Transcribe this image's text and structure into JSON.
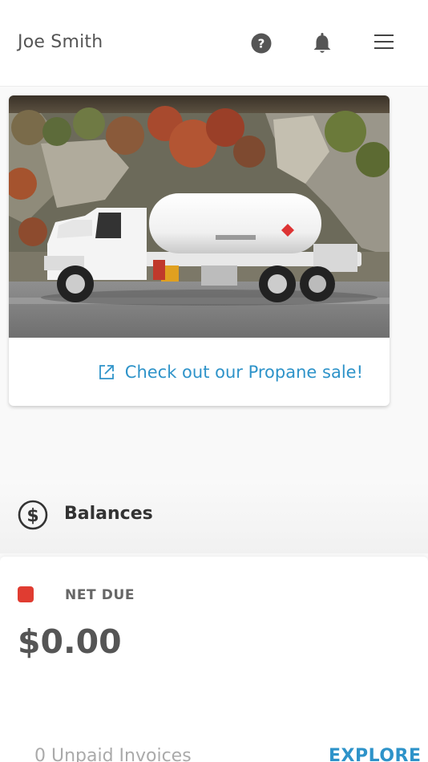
{
  "header": {
    "user_name": "Joe Smith",
    "icons": [
      "help-icon",
      "bell-icon",
      "hamburger-menu-icon"
    ]
  },
  "promo": {
    "image": "propane-truck-photo",
    "link_icon": "external-link-icon",
    "link_label": "Check out our Propane sale!"
  },
  "balances": {
    "icon": "dollar-circle-icon",
    "title": "Balances",
    "net_due_label": "NET DUE",
    "net_due_amount": "$0.00",
    "status_color": "#e03c31",
    "unpaid_invoices": "0 Unpaid Invoices",
    "explore_label": "EXPLORE"
  },
  "colors": {
    "accent": "#2e93c9",
    "status_red": "#e03c31"
  }
}
